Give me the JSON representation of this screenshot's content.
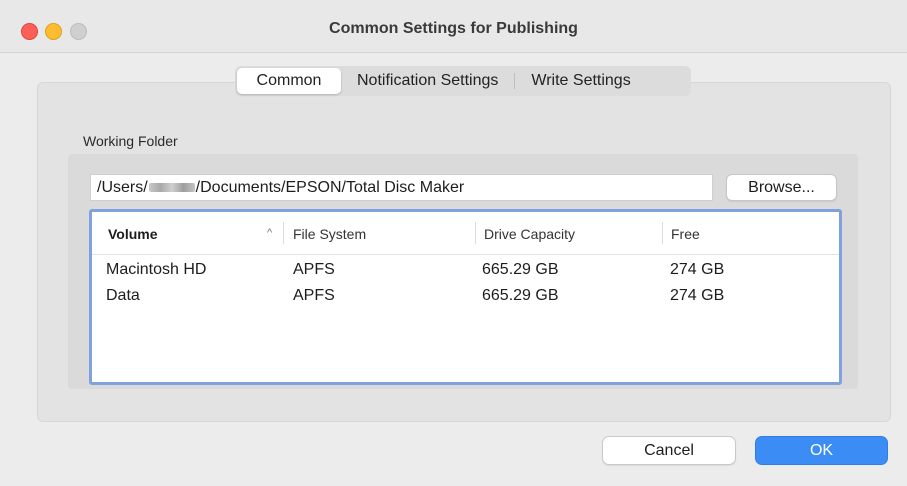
{
  "window": {
    "title": "Common Settings for Publishing"
  },
  "tabs": [
    {
      "label": "Common",
      "active": true
    },
    {
      "label": "Notification Settings",
      "active": false
    },
    {
      "label": "Write Settings",
      "active": false
    }
  ],
  "working_folder": {
    "label": "Working Folder",
    "path_prefix": "/Users/",
    "path_suffix": "/Documents/EPSON/Total Disc Maker",
    "browse_label": "Browse..."
  },
  "table": {
    "columns": [
      "Volume",
      "File System",
      "Drive Capacity",
      "Free"
    ],
    "sort_indicator": "^",
    "rows": [
      {
        "volume": "Macintosh HD",
        "fs": "APFS",
        "capacity": "665.29 GB",
        "free": "274 GB"
      },
      {
        "volume": "Data",
        "fs": "APFS",
        "capacity": "665.29 GB",
        "free": "274 GB"
      }
    ]
  },
  "buttons": {
    "cancel": "Cancel",
    "ok": "OK"
  },
  "colors": {
    "accent": "#3b8cf4",
    "table_focus": "#7fa2df"
  }
}
